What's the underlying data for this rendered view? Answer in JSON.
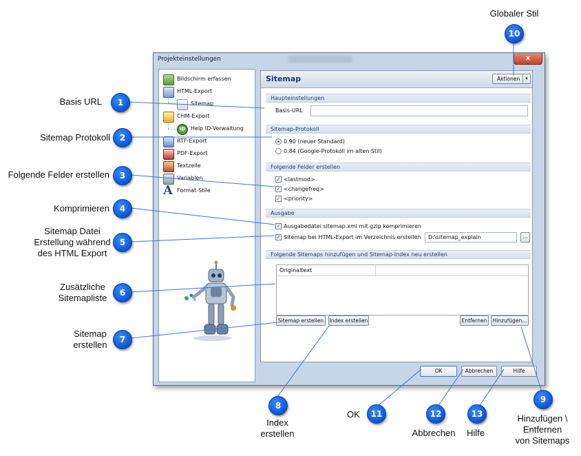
{
  "window": {
    "title": "Projekteinstellungen",
    "close_label": "x"
  },
  "tree": [
    {
      "label": "Bildschirm erfassen",
      "icon": "screen-capture-icon"
    },
    {
      "label": "HTML-Export",
      "icon": "html-export-icon"
    },
    {
      "label": "Sitemap",
      "icon": "sitemap-icon"
    },
    {
      "label": "CHM-Export",
      "icon": "chm-export-icon"
    },
    {
      "label": "Help ID-Verwaltung",
      "icon": "help-id-icon"
    },
    {
      "label": "RTF-Export",
      "icon": "rtf-export-icon"
    },
    {
      "label": "PDF-Export",
      "icon": "pdf-export-icon"
    },
    {
      "label": "Textzeile",
      "icon": "textline-icon"
    },
    {
      "label": "Variablen",
      "icon": "variables-icon"
    },
    {
      "label": "Format-Stile",
      "icon": "format-styles-icon"
    }
  ],
  "panel": {
    "title": "Sitemap",
    "actions_label": "Aktionen"
  },
  "sections": {
    "main": "Haupteinstellungen",
    "protocol": "Sitemap-Protokoll",
    "fields": "Folgende Felder erstellen",
    "output": "Ausgabe",
    "additional": "Folgende Sitemaps hinzufügen und Sitemap-Index neu erstellen"
  },
  "main": {
    "base_url_label": "Basis-URL",
    "base_url_value": ""
  },
  "protocol": {
    "option1": "0.90 (neuer Standard)",
    "option2": "0.84 (Google-Protokoll im alten Stil)",
    "selected": 0
  },
  "fields": {
    "lastmod": "<lastmod>",
    "changefreq": "<changefreq>",
    "priority": "<priority>"
  },
  "output": {
    "gzip_label": "Ausgabedatei sitemap.xml mit gzip komprimieren",
    "html_export_label": "Sitemap bei HTML-Export im Verzeichnis erstellen",
    "path_value": "D:\\sitemap_explain",
    "browse_label": "..."
  },
  "table": {
    "column1": "Originaltext"
  },
  "buttons": {
    "create_sitemap": "Sitemap erstellen",
    "create_index": "Index erstellen",
    "remove": "Entfernen",
    "add": "Hinzufügen...",
    "ok": "OK",
    "cancel": "Abbrechen",
    "help": "Hilfe"
  },
  "annotations": {
    "a1": {
      "num": "1",
      "text": "Basis URL"
    },
    "a2": {
      "num": "2",
      "text": "Sitemap Protokoll"
    },
    "a3": {
      "num": "3",
      "text": "Folgende Felder erstellen"
    },
    "a4": {
      "num": "4",
      "text": "Komprimieren"
    },
    "a5": {
      "num": "5",
      "line1": "Sitemap Datei",
      "line2": "Erstellung während",
      "line3": "des HTML Export"
    },
    "a6": {
      "num": "6",
      "line1": "Zusätzliche",
      "line2": "Sitemapliste"
    },
    "a7": {
      "num": "7",
      "line1": "Sitemap",
      "line2": "erstellen"
    },
    "a8": {
      "num": "8",
      "line1": "Index",
      "line2": "erstellen"
    },
    "a9": {
      "num": "9",
      "line1": "Hinzufügen \\",
      "line2": "Entfernen",
      "line3": "von Sitemaps"
    },
    "a10": {
      "num": "10",
      "text": "Globaler Stil"
    },
    "a11": {
      "num": "11",
      "text": "OK"
    },
    "a12": {
      "num": "12",
      "text": "Abbrechen"
    },
    "a13": {
      "num": "13",
      "text": "Hilfe"
    }
  },
  "colors": {
    "badge": "#0a55d6",
    "section_text": "#1f3a6e",
    "window_frame": "#c6d5e8"
  }
}
